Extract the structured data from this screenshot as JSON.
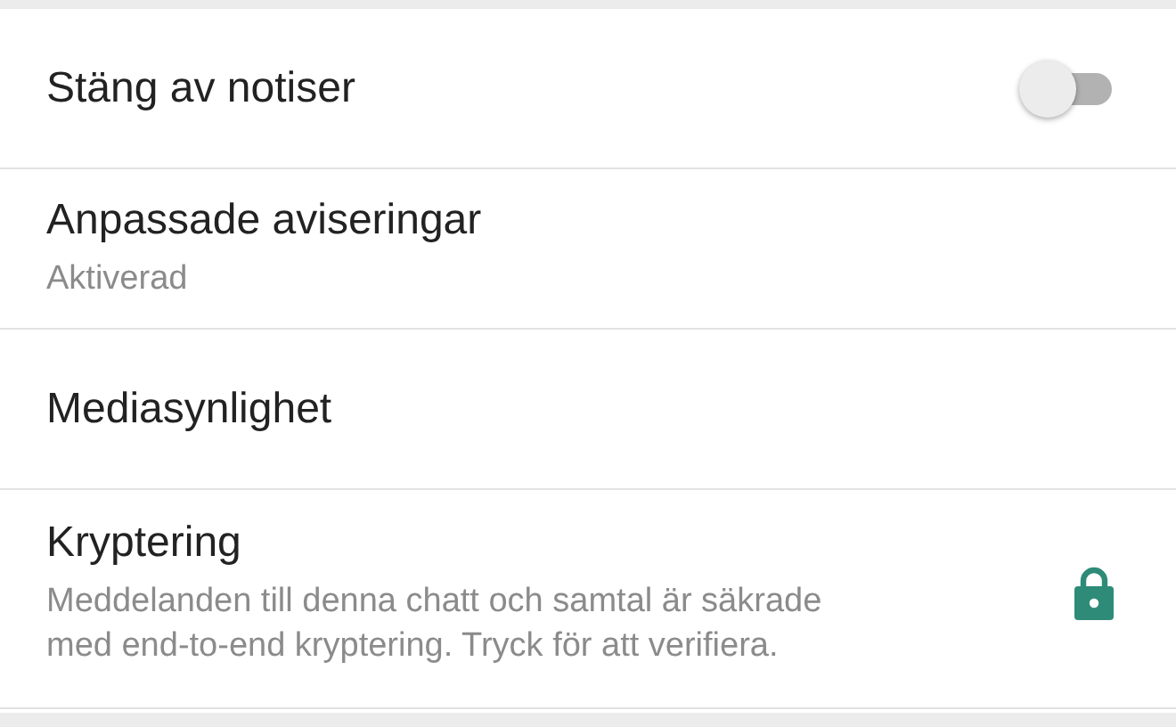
{
  "settings": [
    {
      "kind": "toggle",
      "title": "Stäng av notiser",
      "on": false
    },
    {
      "kind": "text",
      "title": "Anpassade aviseringar",
      "subtitle": "Aktiverad"
    },
    {
      "kind": "text",
      "title": "Mediasynlighet"
    },
    {
      "kind": "lock",
      "title": "Kryptering",
      "subtitle": "Meddelanden till denna chatt och samtal är säkrade med end-to-end kryptering. Tryck för att verifiera."
    }
  ]
}
